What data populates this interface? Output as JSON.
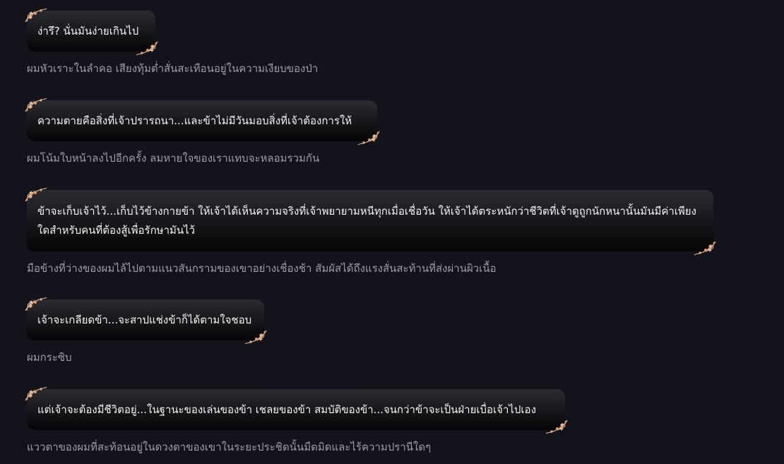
{
  "colors": {
    "background": "#13131c",
    "bubble_text": "#f2f2f4",
    "narration_text": "#9d9da8",
    "ornament": "#e6b38d"
  },
  "blocks": [
    {
      "dialogue": "ง่ารึ? นั่นมันง่ายเกินไป",
      "narration": "ผมหัวเราะในลำคอ เสียงทุ้มต่ำสั่นสะเทือนอยู่ในความเงียบของป่า"
    },
    {
      "dialogue": "ความตายคือสิ่งที่เจ้าปรารถนา...และข้าไม่มีวันมอบสิ่งที่เจ้าต้องการให้",
      "narration": "ผมโน้มใบหน้าลงไปอีกครั้ง ลมหายใจของเราแทบจะหลอมรวมกัน"
    },
    {
      "dialogue": "ข้าจะเก็บเจ้าไว้...เก็บไว้ข้างกายข้า ให้เจ้าได้เห็นความจริงที่เจ้าพยายามหนีทุกเมื่อเชื่อวัน ให้เจ้าได้ตระหนักว่าชีวิตที่เจ้าดูถูกนักหนานั้นมันมีค่าเพียงใดสำหรับคนที่ต้องสู้เพื่อรักษามันไว้",
      "narration": "มือข้างที่ว่างของผมไล้ไปตามแนวสันกรามของเขาอย่างเชื่องช้า สัมผัสได้ถึงแรงสั่นสะท้านที่ส่งผ่านผิวเนื้อ"
    },
    {
      "dialogue": "เจ้าจะเกลียดข้า...จะสาปแช่งข้าก็ได้ตามใจชอบ",
      "narration": "ผมกระซิบ"
    },
    {
      "dialogue": "แต่เจ้าจะต้องมีชีวิตอยู่...ในฐานะของเล่นของข้า เชลยของข้า สมบัติของข้า...จนกว่าข้าจะเป็นฝ่ายเบื่อเจ้าไปเอง",
      "narration": "แววตาของผมที่สะท้อนอยู่ในดวงตาของเขาในระยะประชิดนั้นมืดมิดและไร้ความปรานีใดๆ"
    }
  ]
}
